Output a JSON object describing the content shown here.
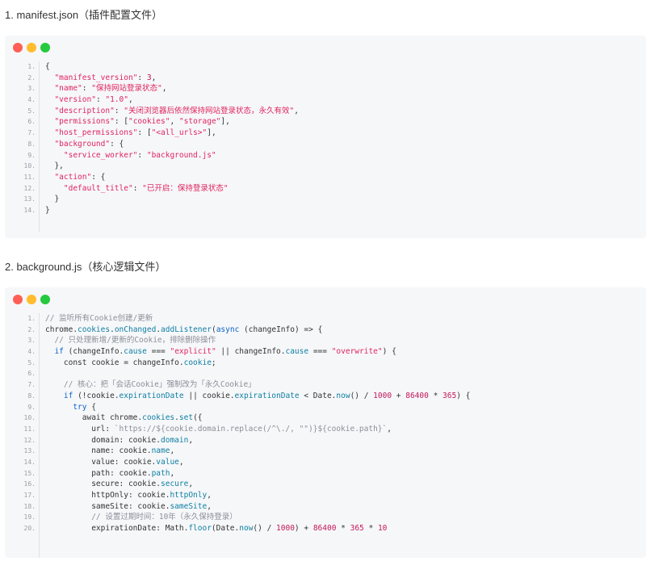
{
  "colors": {
    "dot_red": "#ff5f56",
    "dot_yellow": "#ffbd2e",
    "dot_green": "#27c93f",
    "code_default": "#333333",
    "code_string": "#e0245e",
    "code_keyword": "#0b61c7",
    "code_number": "#c2185b",
    "code_comment": "#8a8f98",
    "code_method": "#0e7fa3"
  },
  "sections": [
    {
      "heading": "1. manifest.json（插件配置文件）",
      "lines": [
        {
          "n": "1.",
          "tokens": [
            {
              "t": "{",
              "c": "code_default"
            }
          ]
        },
        {
          "n": "2.",
          "tokens": [
            {
              "t": "  ",
              "c": "code_default"
            },
            {
              "t": "\"manifest_version\"",
              "c": "code_string"
            },
            {
              "t": ": ",
              "c": "code_default"
            },
            {
              "t": "3",
              "c": "code_number"
            },
            {
              "t": ",",
              "c": "code_default"
            }
          ]
        },
        {
          "n": "3.",
          "tokens": [
            {
              "t": "  ",
              "c": "code_default"
            },
            {
              "t": "\"name\"",
              "c": "code_string"
            },
            {
              "t": ": ",
              "c": "code_default"
            },
            {
              "t": "\"保持网站登录状态\"",
              "c": "code_string"
            },
            {
              "t": ",",
              "c": "code_default"
            }
          ]
        },
        {
          "n": "4.",
          "tokens": [
            {
              "t": "  ",
              "c": "code_default"
            },
            {
              "t": "\"version\"",
              "c": "code_string"
            },
            {
              "t": ": ",
              "c": "code_default"
            },
            {
              "t": "\"1.0\"",
              "c": "code_string"
            },
            {
              "t": ",",
              "c": "code_default"
            }
          ]
        },
        {
          "n": "5.",
          "tokens": [
            {
              "t": "  ",
              "c": "code_default"
            },
            {
              "t": "\"description\"",
              "c": "code_string"
            },
            {
              "t": ": ",
              "c": "code_default"
            },
            {
              "t": "\"关闭浏览器后依然保持网站登录状态，永久有效\"",
              "c": "code_string"
            },
            {
              "t": ",",
              "c": "code_default"
            }
          ]
        },
        {
          "n": "6.",
          "tokens": [
            {
              "t": "  ",
              "c": "code_default"
            },
            {
              "t": "\"permissions\"",
              "c": "code_string"
            },
            {
              "t": ": [",
              "c": "code_default"
            },
            {
              "t": "\"cookies\"",
              "c": "code_string"
            },
            {
              "t": ", ",
              "c": "code_default"
            },
            {
              "t": "\"storage\"",
              "c": "code_string"
            },
            {
              "t": "],",
              "c": "code_default"
            }
          ]
        },
        {
          "n": "7.",
          "tokens": [
            {
              "t": "  ",
              "c": "code_default"
            },
            {
              "t": "\"host_permissions\"",
              "c": "code_string"
            },
            {
              "t": ": [",
              "c": "code_default"
            },
            {
              "t": "\"<all_urls>\"",
              "c": "code_string"
            },
            {
              "t": "],",
              "c": "code_default"
            }
          ]
        },
        {
          "n": "8.",
          "tokens": [
            {
              "t": "  ",
              "c": "code_default"
            },
            {
              "t": "\"background\"",
              "c": "code_string"
            },
            {
              "t": ": {",
              "c": "code_default"
            }
          ]
        },
        {
          "n": "9.",
          "tokens": [
            {
              "t": "    ",
              "c": "code_default"
            },
            {
              "t": "\"service_worker\"",
              "c": "code_string"
            },
            {
              "t": ": ",
              "c": "code_default"
            },
            {
              "t": "\"background.js\"",
              "c": "code_string"
            }
          ]
        },
        {
          "n": "10.",
          "tokens": [
            {
              "t": "  },",
              "c": "code_default"
            }
          ]
        },
        {
          "n": "11.",
          "tokens": [
            {
              "t": "  ",
              "c": "code_default"
            },
            {
              "t": "\"action\"",
              "c": "code_string"
            },
            {
              "t": ": {",
              "c": "code_default"
            }
          ]
        },
        {
          "n": "12.",
          "tokens": [
            {
              "t": "    ",
              "c": "code_default"
            },
            {
              "t": "\"default_title\"",
              "c": "code_string"
            },
            {
              "t": ": ",
              "c": "code_default"
            },
            {
              "t": "\"已开启：保持登录状态\"",
              "c": "code_string"
            }
          ]
        },
        {
          "n": "13.",
          "tokens": [
            {
              "t": "  }",
              "c": "code_default"
            }
          ]
        },
        {
          "n": "14.",
          "tokens": [
            {
              "t": "}",
              "c": "code_default"
            }
          ]
        }
      ]
    },
    {
      "heading": "2. background.js（核心逻辑文件）",
      "lines": [
        {
          "n": "1.",
          "tokens": [
            {
              "t": "// 监听所有Cookie创建/更新",
              "c": "code_comment"
            }
          ]
        },
        {
          "n": "2.",
          "tokens": [
            {
              "t": "chrome.",
              "c": "code_default"
            },
            {
              "t": "cookies",
              "c": "code_method"
            },
            {
              "t": ".",
              "c": "code_default"
            },
            {
              "t": "onChanged",
              "c": "code_method"
            },
            {
              "t": ".",
              "c": "code_default"
            },
            {
              "t": "addListener",
              "c": "code_method"
            },
            {
              "t": "(",
              "c": "code_default"
            },
            {
              "t": "async",
              "c": "code_keyword"
            },
            {
              "t": " (changeInfo) => {",
              "c": "code_default"
            }
          ]
        },
        {
          "n": "3.",
          "tokens": [
            {
              "t": "  ",
              "c": "code_default"
            },
            {
              "t": "// 只处理新增/更新的Cookie，排除删除操作",
              "c": "code_comment"
            }
          ]
        },
        {
          "n": "4.",
          "tokens": [
            {
              "t": "  ",
              "c": "code_default"
            },
            {
              "t": "if",
              "c": "code_keyword"
            },
            {
              "t": " (changeInfo.",
              "c": "code_default"
            },
            {
              "t": "cause",
              "c": "code_method"
            },
            {
              "t": " === ",
              "c": "code_default"
            },
            {
              "t": "\"explicit\"",
              "c": "code_string"
            },
            {
              "t": " || changeInfo.",
              "c": "code_default"
            },
            {
              "t": "cause",
              "c": "code_method"
            },
            {
              "t": " === ",
              "c": "code_default"
            },
            {
              "t": "\"overwrite\"",
              "c": "code_string"
            },
            {
              "t": ") {",
              "c": "code_default"
            }
          ]
        },
        {
          "n": "5.",
          "tokens": [
            {
              "t": "    const cookie = changeInfo.",
              "c": "code_default"
            },
            {
              "t": "cookie",
              "c": "code_method"
            },
            {
              "t": ";",
              "c": "code_default"
            }
          ]
        },
        {
          "n": "6.",
          "tokens": [
            {
              "t": "",
              "c": "code_default"
            }
          ]
        },
        {
          "n": "7.",
          "tokens": [
            {
              "t": "    ",
              "c": "code_default"
            },
            {
              "t": "// 核心：把「会话Cookie」强制改为「永久Cookie」",
              "c": "code_comment"
            }
          ]
        },
        {
          "n": "8.",
          "tokens": [
            {
              "t": "    ",
              "c": "code_default"
            },
            {
              "t": "if",
              "c": "code_keyword"
            },
            {
              "t": " (!cookie.",
              "c": "code_default"
            },
            {
              "t": "expirationDate",
              "c": "code_method"
            },
            {
              "t": " || cookie.",
              "c": "code_default"
            },
            {
              "t": "expirationDate",
              "c": "code_method"
            },
            {
              "t": " < Date.",
              "c": "code_default"
            },
            {
              "t": "now",
              "c": "code_method"
            },
            {
              "t": "() / ",
              "c": "code_default"
            },
            {
              "t": "1000",
              "c": "code_number"
            },
            {
              "t": " + ",
              "c": "code_default"
            },
            {
              "t": "86400",
              "c": "code_number"
            },
            {
              "t": " * ",
              "c": "code_default"
            },
            {
              "t": "365",
              "c": "code_number"
            },
            {
              "t": ") {",
              "c": "code_default"
            }
          ]
        },
        {
          "n": "9.",
          "tokens": [
            {
              "t": "      ",
              "c": "code_default"
            },
            {
              "t": "try",
              "c": "code_keyword"
            },
            {
              "t": " {",
              "c": "code_default"
            }
          ]
        },
        {
          "n": "10.",
          "tokens": [
            {
              "t": "        await chrome.",
              "c": "code_default"
            },
            {
              "t": "cookies",
              "c": "code_method"
            },
            {
              "t": ".",
              "c": "code_default"
            },
            {
              "t": "set",
              "c": "code_method"
            },
            {
              "t": "({",
              "c": "code_default"
            }
          ]
        },
        {
          "n": "11.",
          "tokens": [
            {
              "t": "          url: ",
              "c": "code_default"
            },
            {
              "t": "`https://${cookie.domain.replace(/^\\./, \"\")}${cookie.path}`",
              "c": "code_comment"
            },
            {
              "t": ",",
              "c": "code_default"
            }
          ]
        },
        {
          "n": "12.",
          "tokens": [
            {
              "t": "          domain: cookie.",
              "c": "code_default"
            },
            {
              "t": "domain",
              "c": "code_method"
            },
            {
              "t": ",",
              "c": "code_default"
            }
          ]
        },
        {
          "n": "13.",
          "tokens": [
            {
              "t": "          name: cookie.",
              "c": "code_default"
            },
            {
              "t": "name",
              "c": "code_method"
            },
            {
              "t": ",",
              "c": "code_default"
            }
          ]
        },
        {
          "n": "14.",
          "tokens": [
            {
              "t": "          value: cookie.",
              "c": "code_default"
            },
            {
              "t": "value",
              "c": "code_method"
            },
            {
              "t": ",",
              "c": "code_default"
            }
          ]
        },
        {
          "n": "15.",
          "tokens": [
            {
              "t": "          path: cookie.",
              "c": "code_default"
            },
            {
              "t": "path",
              "c": "code_method"
            },
            {
              "t": ",",
              "c": "code_default"
            }
          ]
        },
        {
          "n": "16.",
          "tokens": [
            {
              "t": "          secure: cookie.",
              "c": "code_default"
            },
            {
              "t": "secure",
              "c": "code_method"
            },
            {
              "t": ",",
              "c": "code_default"
            }
          ]
        },
        {
          "n": "17.",
          "tokens": [
            {
              "t": "          httpOnly: cookie.",
              "c": "code_default"
            },
            {
              "t": "httpOnly",
              "c": "code_method"
            },
            {
              "t": ",",
              "c": "code_default"
            }
          ]
        },
        {
          "n": "18.",
          "tokens": [
            {
              "t": "          sameSite: cookie.",
              "c": "code_default"
            },
            {
              "t": "sameSite",
              "c": "code_method"
            },
            {
              "t": ",",
              "c": "code_default"
            }
          ]
        },
        {
          "n": "19.",
          "tokens": [
            {
              "t": "          ",
              "c": "code_default"
            },
            {
              "t": "// 设置过期时间：10年（永久保持登录）",
              "c": "code_comment"
            }
          ]
        },
        {
          "n": "20.",
          "tokens": [
            {
              "t": "          expirationDate: Math.",
              "c": "code_default"
            },
            {
              "t": "floor",
              "c": "code_method"
            },
            {
              "t": "(Date.",
              "c": "code_default"
            },
            {
              "t": "now",
              "c": "code_method"
            },
            {
              "t": "() / ",
              "c": "code_default"
            },
            {
              "t": "1000",
              "c": "code_number"
            },
            {
              "t": ") + ",
              "c": "code_default"
            },
            {
              "t": "86400",
              "c": "code_number"
            },
            {
              "t": " * ",
              "c": "code_default"
            },
            {
              "t": "365",
              "c": "code_number"
            },
            {
              "t": " * ",
              "c": "code_default"
            },
            {
              "t": "10",
              "c": "code_number"
            }
          ]
        }
      ]
    }
  ]
}
